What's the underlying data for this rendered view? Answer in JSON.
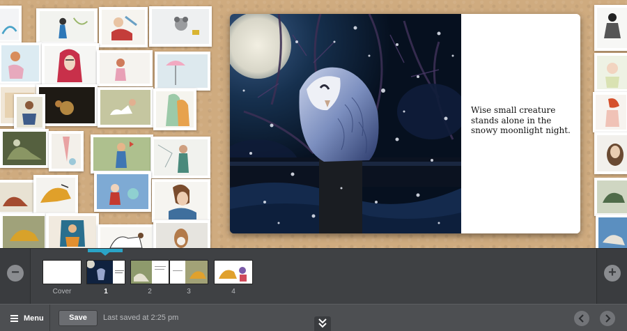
{
  "spread": {
    "caption": "Wise small creature stands alone in the snowy moonlight night."
  },
  "filmstrip": {
    "zoom_out_symbol": "−",
    "zoom_in_symbol": "+",
    "pages": [
      {
        "label": "Cover",
        "active": false
      },
      {
        "label": "1",
        "active": true
      },
      {
        "label": "2",
        "active": false
      },
      {
        "label": "3",
        "active": false
      },
      {
        "label": "4",
        "active": false
      }
    ]
  },
  "toolbar": {
    "menu_label": "Menu",
    "save_label": "Save",
    "saved_status": "Last saved at 2:25 pm"
  },
  "colors": {
    "accent": "#2aa4c6",
    "board": "#cfab7f",
    "toolbar": "#4d4f52"
  }
}
